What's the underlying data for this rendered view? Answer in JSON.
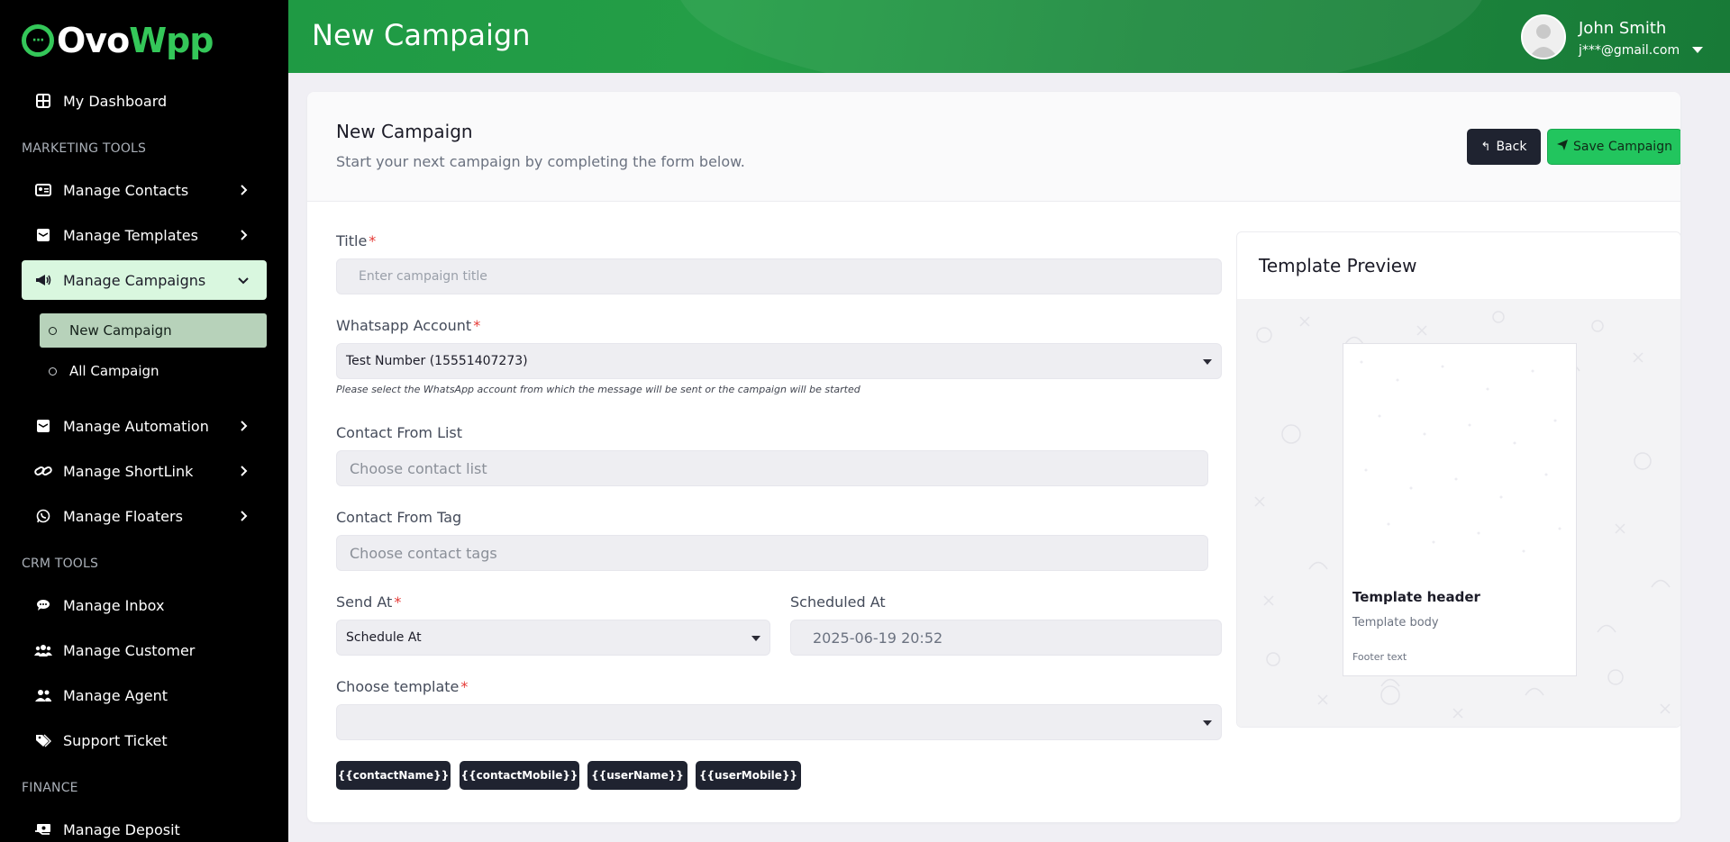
{
  "brand": {
    "part1": "Ovo",
    "part2": "Wpp"
  },
  "sidebar": {
    "dashboard": "My Dashboard",
    "section_marketing": "MARKETING TOOLS",
    "manage_contacts": "Manage Contacts",
    "manage_templates": "Manage Templates",
    "manage_campaigns": "Manage Campaigns",
    "new_campaign": "New Campaign",
    "all_campaign": "All Campaign",
    "manage_automation": "Manage Automation",
    "manage_shortlink": "Manage ShortLink",
    "manage_floaters": "Manage Floaters",
    "section_crm": "CRM TOOLS",
    "manage_inbox": "Manage Inbox",
    "manage_customer": "Manage Customer",
    "manage_agent": "Manage Agent",
    "support_ticket": "Support Ticket",
    "section_finance": "FINANCE",
    "manage_deposit": "Manage Deposit"
  },
  "header": {
    "title": "New Campaign",
    "user_name": "John Smith",
    "user_email": "j***@gmail.com"
  },
  "card": {
    "title": "New Campaign",
    "subtitle": "Start your next campaign by completing the form below.",
    "back_label": "Back",
    "save_label": "Save Campaign"
  },
  "form": {
    "title_label": "Title",
    "title_placeholder": "Enter campaign title",
    "account_label": "Whatsapp Account",
    "account_value": "Test Number (15551407273)",
    "account_hint": "Please select the WhatsApp account from which the message will be sent or the campaign will be started",
    "contact_list_label": "Contact From List",
    "contact_list_placeholder": "Choose contact list",
    "contact_tag_label": "Contact From Tag",
    "contact_tag_placeholder": "Choose contact tags",
    "send_at_label": "Send At",
    "send_at_value": "Schedule At",
    "scheduled_at_label": "Scheduled At",
    "scheduled_at_value": "2025-06-19 20:52",
    "template_label": "Choose template",
    "template_value": "",
    "required_mark": "*",
    "variables": [
      "{{contactName}}",
      "{{contactMobile}}",
      "{{userName}}",
      "{{userMobile}}"
    ]
  },
  "preview": {
    "title": "Template Preview",
    "header": "Template header",
    "body": "Template body",
    "footer": "Footer text"
  },
  "colors": {
    "brand_green": "#34c759",
    "topbar_green": "#1f9a44",
    "save_button": "#22c55e",
    "dark_button": "#1f2330",
    "active_nav": "#d9f7df"
  }
}
